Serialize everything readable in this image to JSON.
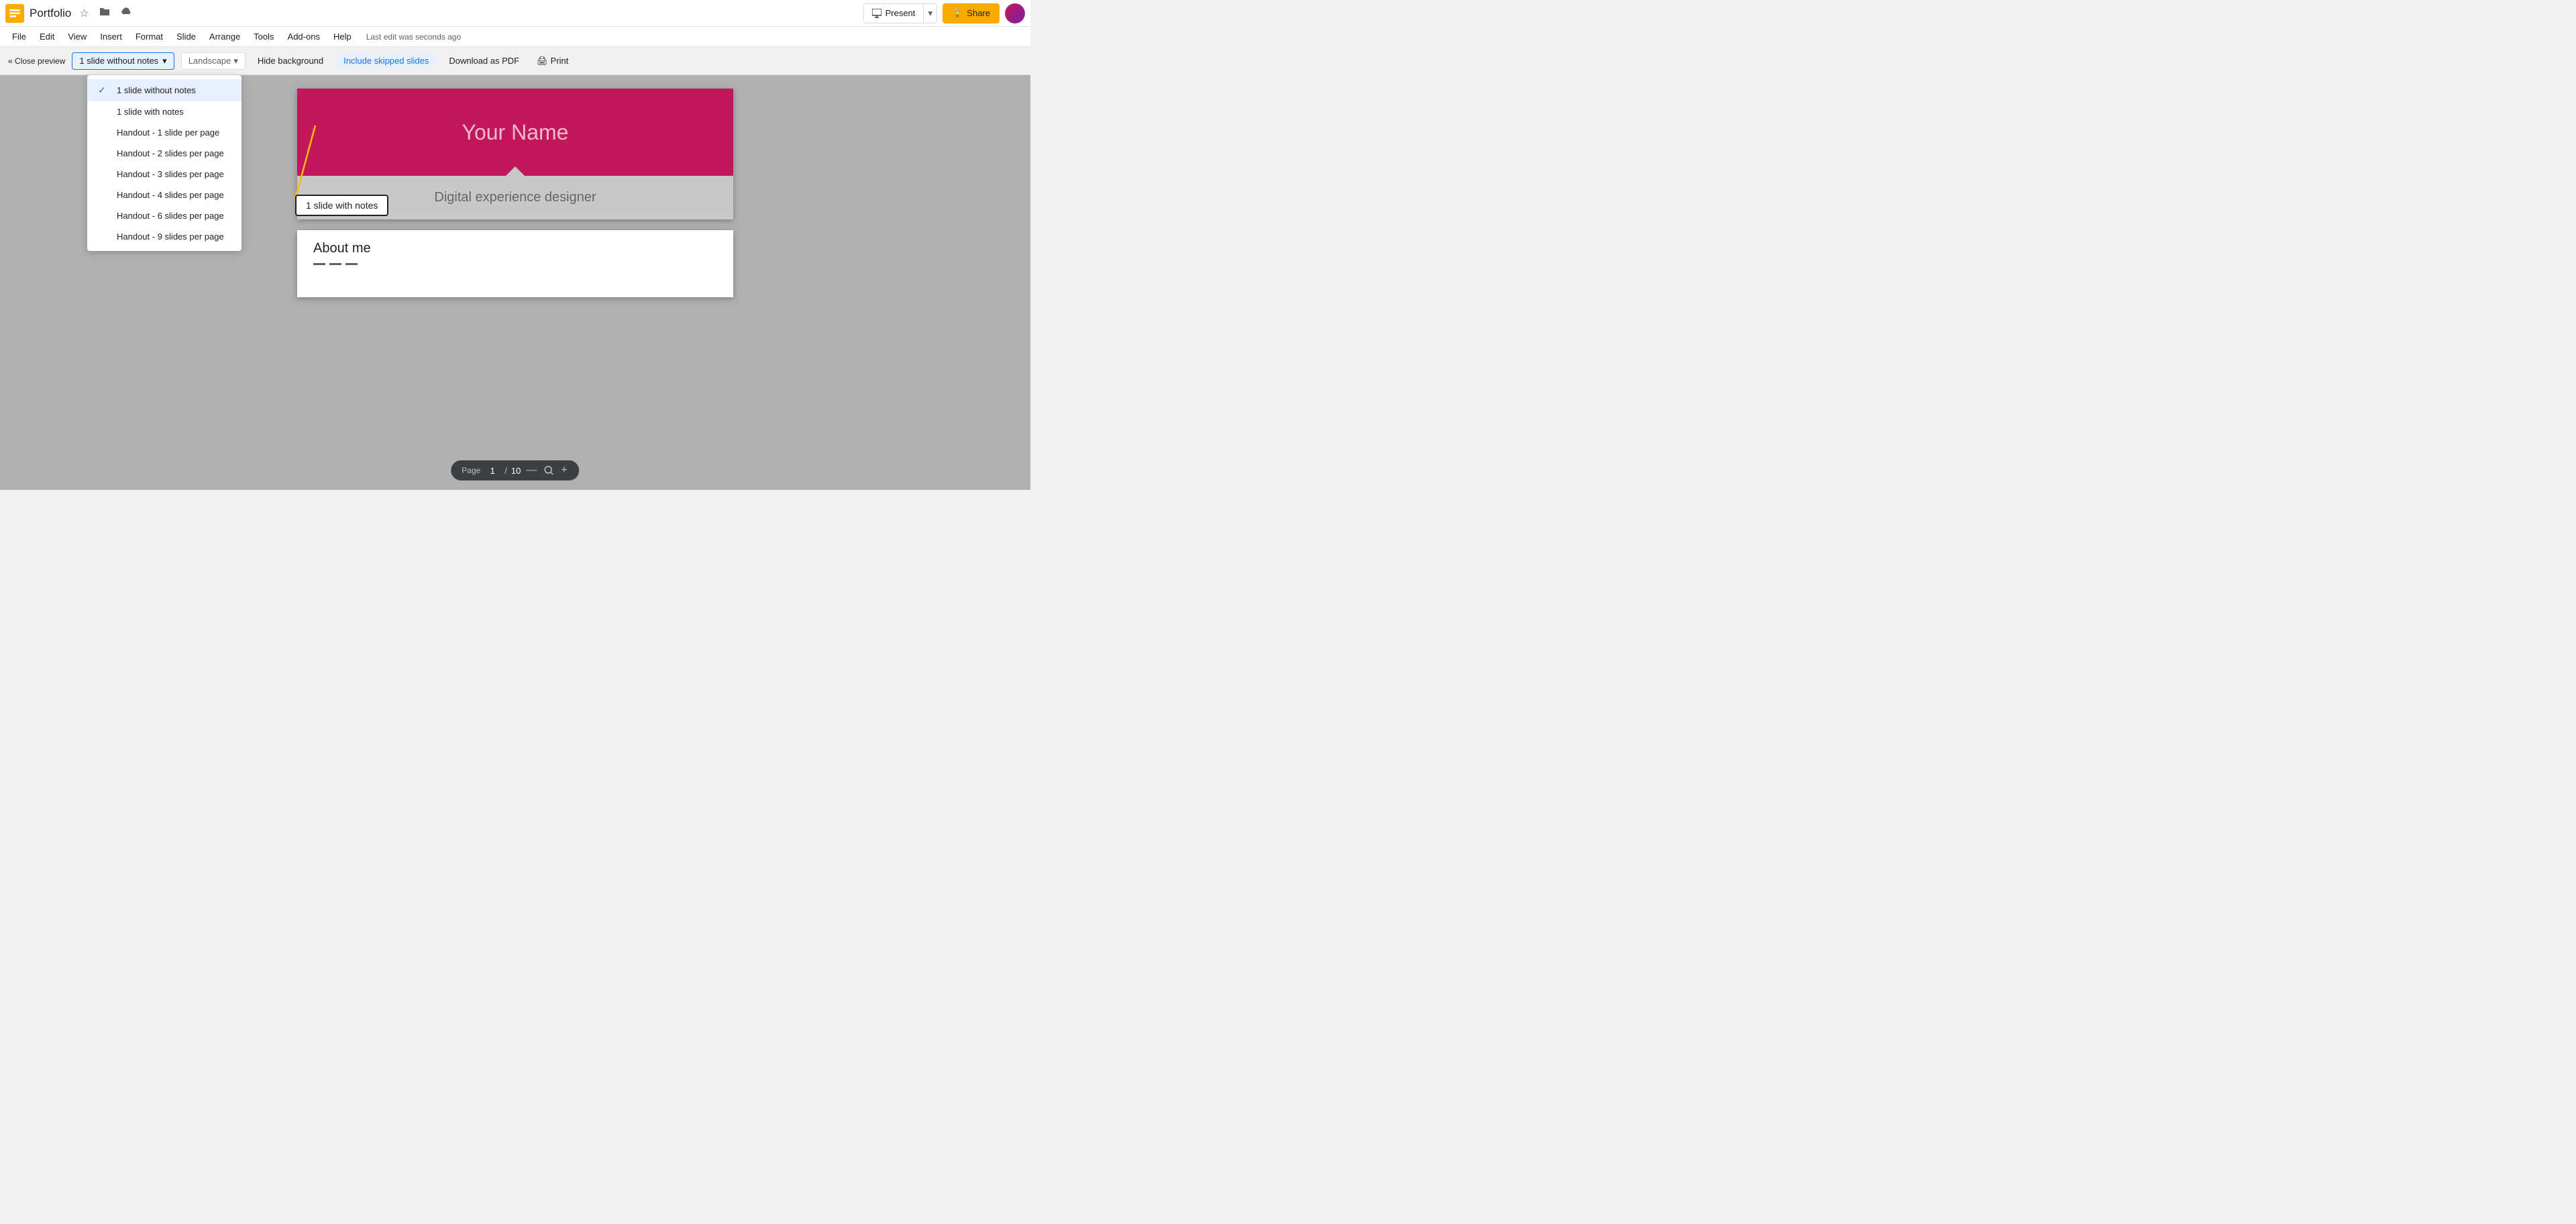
{
  "app": {
    "icon_color": "#f9ab00",
    "title": "Portfolio",
    "last_edit": "Last edit was seconds ago"
  },
  "title_icons": {
    "star": "☆",
    "folder": "🗂",
    "cloud": "☁"
  },
  "header_buttons": {
    "present_label": "Present",
    "share_label": "Share",
    "share_icon": "🔒"
  },
  "menu": {
    "items": [
      "File",
      "Edit",
      "View",
      "Insert",
      "Format",
      "Slide",
      "Arrange",
      "Tools",
      "Add-ons",
      "Help"
    ]
  },
  "preview_bar": {
    "close_label": "« Close preview",
    "layout_label": "1 slide without notes",
    "orientation_label": "Landscape",
    "hide_background_label": "Hide background",
    "include_skipped_label": "Include skipped slides",
    "download_pdf_label": "Download as PDF",
    "print_label": "Print",
    "print_icon": "🖨"
  },
  "dropdown": {
    "items": [
      {
        "id": "1-slide-without-notes",
        "label": "1 slide without notes",
        "selected": true
      },
      {
        "id": "1-slide-with-notes",
        "label": "1 slide with notes",
        "selected": false
      },
      {
        "id": "handout-1",
        "label": "Handout - 1 slide per page",
        "selected": false
      },
      {
        "id": "handout-2",
        "label": "Handout - 2 slides per page",
        "selected": false
      },
      {
        "id": "handout-3",
        "label": "Handout - 3 slides per page",
        "selected": false
      },
      {
        "id": "handout-4",
        "label": "Handout - 4 slides per page",
        "selected": false
      },
      {
        "id": "handout-6",
        "label": "Handout - 6 slides per page",
        "selected": false
      },
      {
        "id": "handout-9",
        "label": "Handout - 9 slides per page",
        "selected": false
      }
    ]
  },
  "slide1": {
    "title": "Your Name",
    "subtitle": "Digital experience designer"
  },
  "slide2": {
    "title": "About me"
  },
  "page_nav": {
    "label": "Page",
    "current": "1",
    "separator": "/",
    "total": "10",
    "minus_icon": "—",
    "zoom_icon": "⊕",
    "plus_icon": "+"
  },
  "annotation": {
    "label": "1 slide with notes"
  }
}
